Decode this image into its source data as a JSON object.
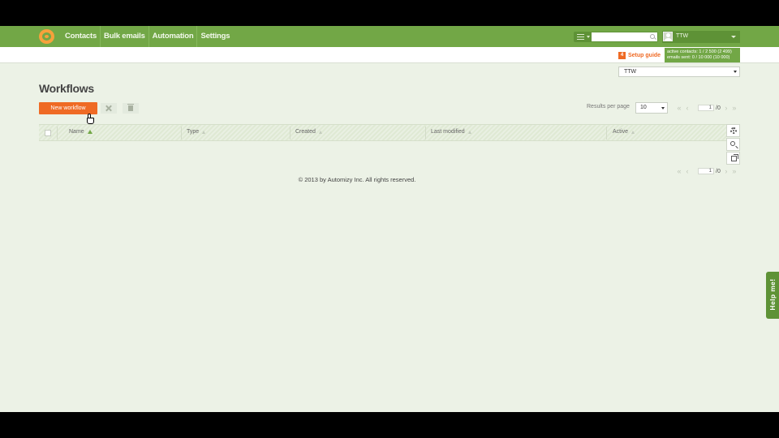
{
  "nav": {
    "items": [
      "Contacts",
      "Bulk emails",
      "Automation",
      "Settings"
    ]
  },
  "search": {
    "placeholder": ""
  },
  "user": {
    "name": "TTW"
  },
  "subbar": {
    "setup_guide": "Setup guide",
    "stats_line1": "active contacts: 1 / 2 500 (2 499)",
    "stats_line2": "emails sent: 0 / 10 000 (10 000)"
  },
  "org_select": {
    "value": "TTW"
  },
  "page": {
    "title": "Workflows"
  },
  "toolbar": {
    "new_workflow": "New workflow"
  },
  "pagination": {
    "results_label": "Results per page",
    "per_page": "10",
    "current_page": "1",
    "total": "/0",
    "first": "«",
    "prev": "‹",
    "next": "›",
    "last": "»"
  },
  "table": {
    "columns": [
      "Name",
      "Type",
      "Created",
      "Last modified",
      "Active"
    ],
    "rows": []
  },
  "footer": {
    "copyright": "© 2013 by Automizy Inc. All rights reserved."
  },
  "help": {
    "label": "Help me!"
  },
  "colors": {
    "brand_green": "#72a746",
    "accent_orange": "#ef6a24",
    "background": "#ecf2e6"
  },
  "icons": [
    "logo",
    "menu-icon",
    "search-icon",
    "avatar",
    "setup-icon",
    "tools-icon",
    "trash-icon",
    "gear-icon",
    "magnifier-icon",
    "export-icon"
  ]
}
